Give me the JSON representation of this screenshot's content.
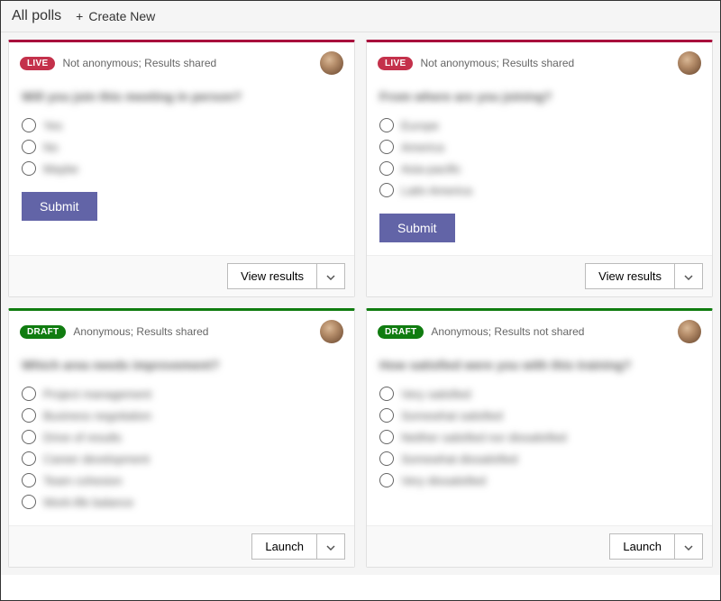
{
  "header": {
    "title": "All polls",
    "create_new_label": "Create New"
  },
  "badges": {
    "live": "LIVE",
    "draft": "DRAFT"
  },
  "buttons": {
    "submit": "Submit",
    "view_results": "View results",
    "launch": "Launch"
  },
  "cards": [
    {
      "status": "live",
      "meta": "Not anonymous; Results shared",
      "question": "Will you join this meeting in person?",
      "options": [
        "Yes",
        "No",
        "Maybe"
      ],
      "has_submit": true,
      "footer_action": "view_results"
    },
    {
      "status": "live",
      "meta": "Not anonymous; Results shared",
      "question": "From where are you joining?",
      "options": [
        "Europe",
        "America",
        "Asia-pacific",
        "Latin America"
      ],
      "has_submit": true,
      "footer_action": "view_results"
    },
    {
      "status": "draft",
      "meta": "Anonymous; Results shared",
      "question": "Which area needs improvement?",
      "options": [
        "Project management",
        "Business negotiation",
        "Drive of results",
        "Career development",
        "Team cohesion",
        "Work-life balance"
      ],
      "has_submit": false,
      "footer_action": "launch"
    },
    {
      "status": "draft",
      "meta": "Anonymous; Results not shared",
      "question": "How satisfied were you with this training?",
      "options": [
        "Very satisfied",
        "Somewhat satisfied",
        "Neither satisfied nor dissatisfied",
        "Somewhat dissatisfied",
        "Very dissatisfied"
      ],
      "has_submit": false,
      "footer_action": "launch"
    }
  ]
}
